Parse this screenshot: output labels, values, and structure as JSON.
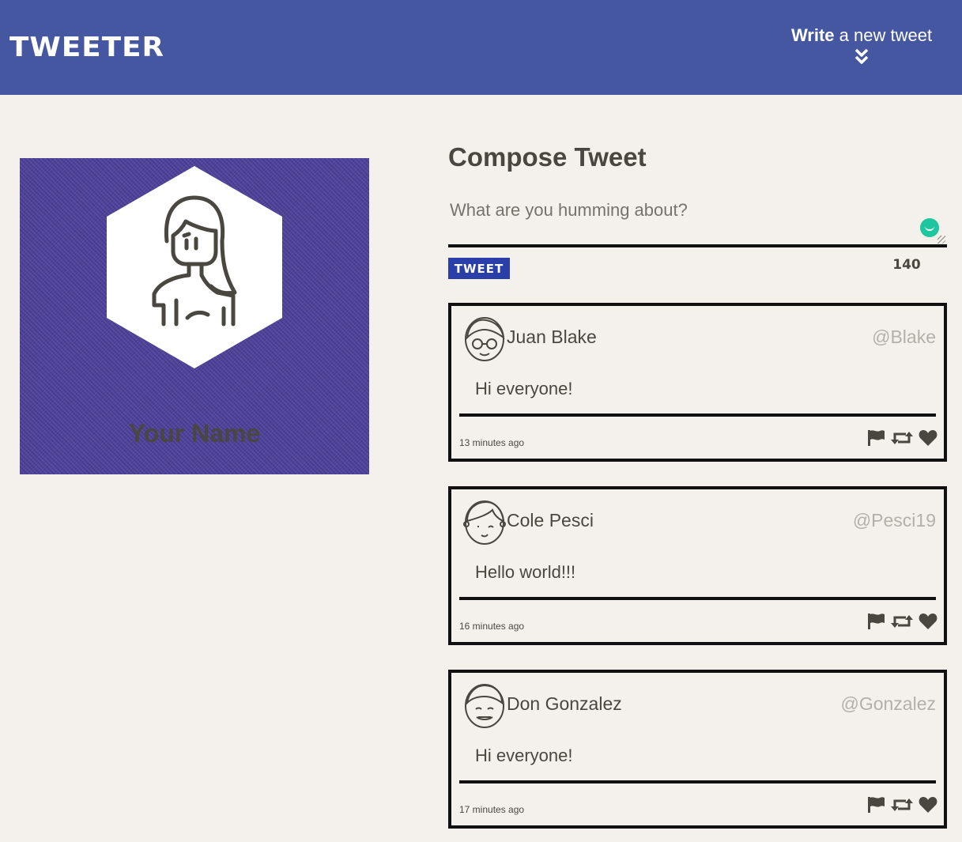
{
  "header": {
    "logo": "TWEETER",
    "compose_toggle": {
      "bold": "Write",
      "rest": " a new tweet"
    }
  },
  "profile": {
    "name": "Your Name"
  },
  "compose": {
    "title": "Compose Tweet",
    "placeholder": "What are you humming about?",
    "button_label": "TWEET",
    "counter": "140"
  },
  "tweets": [
    {
      "author": "Juan Blake",
      "handle": "@Blake",
      "content": "Hi everyone!",
      "time": "13 minutes ago"
    },
    {
      "author": "Cole Pesci",
      "handle": "@Pesci19",
      "content": "Hello world!!!",
      "time": "16 minutes ago"
    },
    {
      "author": "Don Gonzalez",
      "handle": "@Gonzalez",
      "content": "Hi everyone!",
      "time": "17 minutes ago"
    }
  ],
  "colors": {
    "header_bg": "#4557a0",
    "profile_bg": "#4a3d98",
    "button_bg": "#2a3fa8",
    "page_bg": "#f4f1ec",
    "text": "#4a4741",
    "handle": "#b3b0aa"
  }
}
